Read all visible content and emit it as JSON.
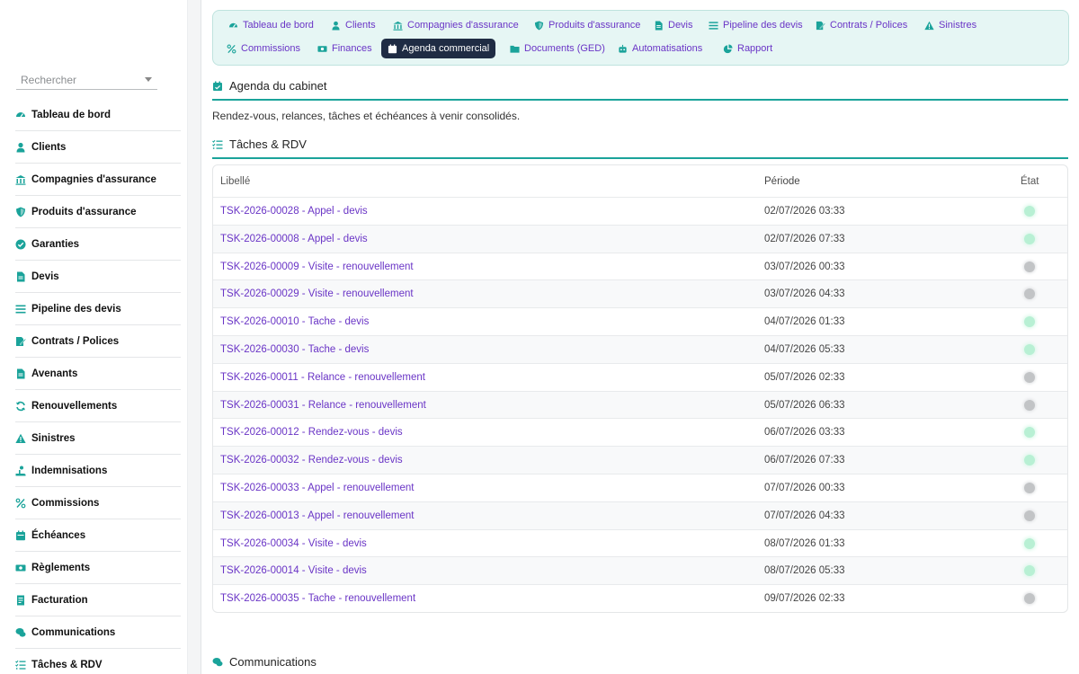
{
  "sidebar": {
    "search_placeholder": "Rechercher",
    "items": [
      {
        "label": "Tableau de bord",
        "icon": "dashboard-icon"
      },
      {
        "label": "Clients",
        "icon": "user-icon"
      },
      {
        "label": "Compagnies d'assurance",
        "icon": "bank-icon"
      },
      {
        "label": "Produits d'assurance",
        "icon": "shield-icon"
      },
      {
        "label": "Garanties",
        "icon": "check-circle-icon"
      },
      {
        "label": "Devis",
        "icon": "file-icon"
      },
      {
        "label": "Pipeline des devis",
        "icon": "bars-icon"
      },
      {
        "label": "Contrats / Polices",
        "icon": "contract-icon"
      },
      {
        "label": "Avenants",
        "icon": "file-icon"
      },
      {
        "label": "Renouvellements",
        "icon": "refresh-icon"
      },
      {
        "label": "Sinistres",
        "icon": "warning-icon"
      },
      {
        "label": "Indemnisations",
        "icon": "hand-coins-icon"
      },
      {
        "label": "Commissions",
        "icon": "percent-icon"
      },
      {
        "label": "Échéances",
        "icon": "calendar-icon"
      },
      {
        "label": "Règlements",
        "icon": "money-icon"
      },
      {
        "label": "Facturation",
        "icon": "invoice-icon"
      },
      {
        "label": "Communications",
        "icon": "chat-icon"
      },
      {
        "label": "Tâches & RDV",
        "icon": "tasks-icon"
      }
    ]
  },
  "tabs": {
    "row1": [
      {
        "label": "Tableau de bord",
        "icon": "dashboard-icon"
      },
      {
        "label": "Clients",
        "icon": "user-icon"
      },
      {
        "label": "Compagnies d'assurance",
        "icon": "bank-icon"
      },
      {
        "label": "Produits d'assurance",
        "icon": "shield-icon"
      },
      {
        "label": "Devis",
        "icon": "file-icon"
      },
      {
        "label": "Pipeline des devis",
        "icon": "bars-icon"
      },
      {
        "label": "Contrats / Polices",
        "icon": "contract-icon"
      },
      {
        "label": "Sinistres",
        "icon": "warning-icon"
      }
    ],
    "row2": [
      {
        "label": "Commissions",
        "icon": "percent-icon"
      },
      {
        "label": "Finances",
        "icon": "money-icon"
      },
      {
        "label": "Agenda commercial",
        "icon": "calendar-icon",
        "active": true
      },
      {
        "label": "Documents (GED)",
        "icon": "folder-icon"
      },
      {
        "label": "Automatisations",
        "icon": "robot-icon"
      },
      {
        "label": "Rapport",
        "icon": "pie-icon"
      }
    ]
  },
  "main": {
    "title": "Agenda du cabinet",
    "description": "Rendez-vous, relances, tâches et échéances à venir consolidés.",
    "tasks_title": "Tâches & RDV",
    "communications_title": "Communications",
    "columns": [
      "Libellé",
      "Période",
      "État"
    ],
    "rows": [
      {
        "label": "TSK-2026-00028 - Appel - devis",
        "period": "02/07/2026 03:33",
        "state": "green"
      },
      {
        "label": "TSK-2026-00008 - Appel - devis",
        "period": "02/07/2026 07:33",
        "state": "green"
      },
      {
        "label": "TSK-2026-00009 - Visite - renouvellement",
        "period": "03/07/2026 00:33",
        "state": "grey"
      },
      {
        "label": "TSK-2026-00029 - Visite - renouvellement",
        "period": "03/07/2026 04:33",
        "state": "grey"
      },
      {
        "label": "TSK-2026-00010 - Tache - devis",
        "period": "04/07/2026 01:33",
        "state": "green"
      },
      {
        "label": "TSK-2026-00030 - Tache - devis",
        "period": "04/07/2026 05:33",
        "state": "green"
      },
      {
        "label": "TSK-2026-00011 - Relance - renouvellement",
        "period": "05/07/2026 02:33",
        "state": "grey"
      },
      {
        "label": "TSK-2026-00031 - Relance - renouvellement",
        "period": "05/07/2026 06:33",
        "state": "grey"
      },
      {
        "label": "TSK-2026-00012 - Rendez-vous - devis",
        "period": "06/07/2026 03:33",
        "state": "green"
      },
      {
        "label": "TSK-2026-00032 - Rendez-vous - devis",
        "period": "06/07/2026 07:33",
        "state": "green"
      },
      {
        "label": "TSK-2026-00033 - Appel - renouvellement",
        "period": "07/07/2026 00:33",
        "state": "grey"
      },
      {
        "label": "TSK-2026-00013 - Appel - renouvellement",
        "period": "07/07/2026 04:33",
        "state": "grey"
      },
      {
        "label": "TSK-2026-00034 - Visite - devis",
        "period": "08/07/2026 01:33",
        "state": "green"
      },
      {
        "label": "TSK-2026-00014 - Visite - devis",
        "period": "08/07/2026 05:33",
        "state": "green"
      },
      {
        "label": "TSK-2026-00035 - Tache - renouvellement",
        "period": "09/07/2026 02:33",
        "state": "grey"
      }
    ]
  },
  "colors": {
    "accent": "#1aa39a",
    "link": "#6a35c6",
    "active_tab": "#1f2c44",
    "state_green": "#b8f0d4",
    "state_grey": "#c2c4c6"
  }
}
